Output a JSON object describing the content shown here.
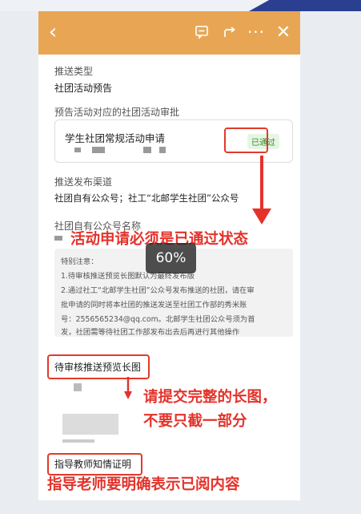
{
  "header": {
    "back_icon": "chevron-left-icon",
    "msg_icon": "message-square-icon",
    "share_icon": "share-icon",
    "more_icon": "more-horizontal-icon",
    "close_icon": "close-icon",
    "accent_color": "#e8a654"
  },
  "form": {
    "push_type_label": "推送类型",
    "push_type_value": "社团活动预告",
    "approval_label": "预告活动对应的社团活动审批",
    "approval_title": "学生社团常规活动申请",
    "approval_status": "已通过",
    "channel_label": "推送发布渠道",
    "channel_value": "社团自有公众号；社工“北邮学生社团”公众号",
    "account_label": "社团自有公众号名称",
    "notice_title": "特别注意：",
    "notice_line1": "1.待审核推送预览长图默认为最终发布版",
    "notice_line2": "2.通过社工“北邮学生社团”公众号发布推送的社团，请在审",
    "notice_line3": "批申请的同时将本社团的推送发送至社团工作部的秀米账",
    "notice_line4": "号：2556565234@qq.com。北邮学生社团公众号须为首",
    "notice_line5": "发，社团需等待社团工作部发布出去后再进行其他操作",
    "preview_label": "待审核推送预览长图",
    "teacher_label": "指导教师知情证明"
  },
  "annotations": {
    "note1": "活动申请必须是已通过状态",
    "note2_line1": "请提交完整的长图，",
    "note2_line2": "不要只截一部分",
    "note3": "指导老师要明确表示已阅内容",
    "red_color": "#e4322a"
  },
  "overlay": {
    "toast": "60%"
  }
}
